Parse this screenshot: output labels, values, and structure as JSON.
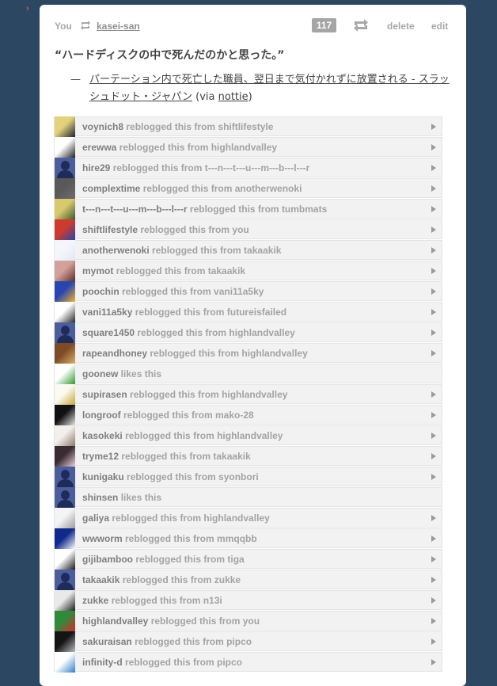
{
  "post": {
    "header": {
      "you_label": "You",
      "reblogged_from_user": "kasei-san",
      "notes_count": "117",
      "delete_label": "delete",
      "edit_label": "edit"
    },
    "quote": {
      "text": "“ハードディスクの中で死んだのかと思った。”",
      "dash": "—",
      "source_link": "パーテーション内で死亡した職員、翌日まで気付かれずに放置される - スラッシュドット・ジャパン",
      "via_prefix": " (via ",
      "via_user": "nottie",
      "via_suffix": ")"
    }
  },
  "notes": [
    {
      "user": "voynich8",
      "action": "reblogged this from",
      "source": "shiftlifestyle",
      "avatar": "av1",
      "colors": [
        "#e3d27a",
        "#1c2238"
      ]
    },
    {
      "user": "erewwa",
      "action": "reblogged this from",
      "source": "highlandvalley",
      "avatar": "av2",
      "colors": [
        "#ffffff",
        "#222222"
      ]
    },
    {
      "user": "hire29",
      "action": "reblogged this from",
      "source": "t---n---t---u---m---b---l---r",
      "avatar": "silhouette",
      "colors": [
        "#4c5d9e",
        "#1e2c59"
      ]
    },
    {
      "user": "complextime",
      "action": "reblogged this from",
      "source": "anotherwenoki",
      "avatar": "av4",
      "colors": [
        "#595959",
        "#6d6d6d"
      ]
    },
    {
      "user": "t---n---t---u---m---b---l---r",
      "action": "reblogged this from",
      "source": "tumbmats",
      "avatar": "av5",
      "colors": [
        "#d8c86e",
        "#3c5a32"
      ]
    },
    {
      "user": "shiftlifestyle",
      "action": "reblogged this from",
      "source": "you",
      "avatar": "av6",
      "colors": [
        "#d03a2d",
        "#2746a8"
      ]
    },
    {
      "user": "anotherwenoki",
      "action": "reblogged this from",
      "source": "takaakik",
      "avatar": "av7",
      "colors": [
        "#f4f6fb",
        "#e2e7f2"
      ]
    },
    {
      "user": "mymot",
      "action": "reblogged this from",
      "source": "takaakik",
      "avatar": "av8",
      "colors": [
        "#d3a09a",
        "#5a2f2b"
      ]
    },
    {
      "user": "poochin",
      "action": "reblogged this from",
      "source": "vani11a5ky",
      "avatar": "av9",
      "colors": [
        "#2846b2",
        "#f5b329"
      ]
    },
    {
      "user": "vani11a5ky",
      "action": "reblogged this from",
      "source": "futureisfailed",
      "avatar": "av10",
      "colors": [
        "#ffffff",
        "#2a2a2a"
      ]
    },
    {
      "user": "square1450",
      "action": "reblogged this from",
      "source": "highlandvalley",
      "avatar": "silhouette",
      "colors": [
        "#4c5d9e",
        "#1e2c59"
      ]
    },
    {
      "user": "rapeandhoney",
      "action": "reblogged this from",
      "source": "highlandvalley",
      "avatar": "av12",
      "colors": [
        "#7d4c27",
        "#dcae6a"
      ]
    },
    {
      "user": "goonew",
      "action": "likes this",
      "source": "",
      "avatar": "av13",
      "colors": [
        "#ffffff",
        "#2e9a2e"
      ]
    },
    {
      "user": "supirasen",
      "action": "reblogged this from",
      "source": "highlandvalley",
      "avatar": "av14",
      "colors": [
        "#fafaf0",
        "#c9a63b"
      ]
    },
    {
      "user": "longroof",
      "action": "reblogged this from",
      "source": "mako-28",
      "avatar": "av15",
      "colors": [
        "#111111",
        "#e6e6e6"
      ]
    },
    {
      "user": "kasokeki",
      "action": "reblogged this from",
      "source": "highlandvalley",
      "avatar": "av16",
      "colors": [
        "#f3efea",
        "#8a7a6a"
      ]
    },
    {
      "user": "tryme12",
      "action": "reblogged this from",
      "source": "takaakik",
      "avatar": "av17",
      "colors": [
        "#3a2a32",
        "#e8d2dc"
      ]
    },
    {
      "user": "kunigaku",
      "action": "reblogged this from",
      "source": "syonbori",
      "avatar": "silhouette",
      "colors": [
        "#4c5d9e",
        "#1e2c59"
      ]
    },
    {
      "user": "shinsen",
      "action": "likes this",
      "source": "",
      "avatar": "silhouette",
      "colors": [
        "#4c5d9e",
        "#1e2c59"
      ]
    },
    {
      "user": "galiya",
      "action": "reblogged this from",
      "source": "highlandvalley",
      "avatar": "av20",
      "colors": [
        "#f4f4f4",
        "#9c9c9c"
      ]
    },
    {
      "user": "wwworm",
      "action": "reblogged this from",
      "source": "mmqqbb",
      "avatar": "av21",
      "colors": [
        "#0f2a8c",
        "#ffffff"
      ]
    },
    {
      "user": "gijibamboo",
      "action": "reblogged this from",
      "source": "tiga",
      "avatar": "av22",
      "colors": [
        "#ffffff",
        "#1a1a1a"
      ]
    },
    {
      "user": "takaakik",
      "action": "reblogged this from",
      "source": "zukke",
      "avatar": "silhouette",
      "colors": [
        "#4c5d9e",
        "#1e2c59"
      ]
    },
    {
      "user": "zukke",
      "action": "reblogged this from",
      "source": "n13i",
      "avatar": "av24",
      "colors": [
        "#e9e9e9",
        "#1f1f1f"
      ]
    },
    {
      "user": "highlandvalley",
      "action": "reblogged this from",
      "source": "you",
      "avatar": "av25",
      "colors": [
        "#2e8b3a",
        "#d9282f"
      ]
    },
    {
      "user": "sakuraisan",
      "action": "reblogged this from",
      "source": "pipco",
      "avatar": "av26",
      "colors": [
        "#141414",
        "#bbbbbb"
      ]
    },
    {
      "user": "infinity-d",
      "action": "reblogged this from",
      "source": "pipco",
      "avatar": "av27",
      "colors": [
        "#ffffff",
        "#2d7fc6"
      ]
    }
  ]
}
